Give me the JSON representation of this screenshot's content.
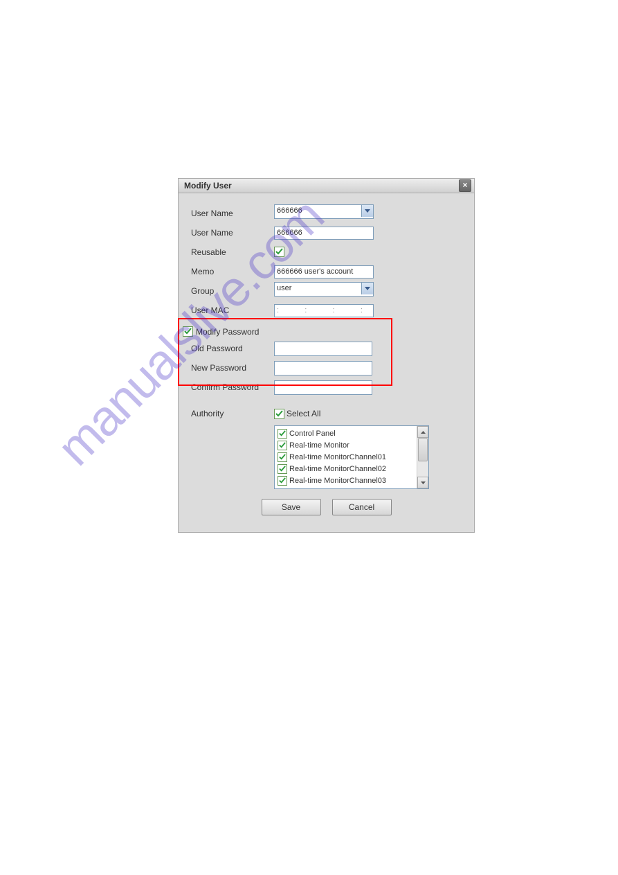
{
  "dialog": {
    "title": "Modify User",
    "fields": {
      "user_name_select_label": "User Name",
      "user_name_select_value": "666666",
      "user_name_text_label": "User Name",
      "user_name_text_value": "666666",
      "reusable_label": "Reusable",
      "reusable_checked": true,
      "memo_label": "Memo",
      "memo_value": "666666 user's account",
      "group_label": "Group",
      "group_value": "user",
      "user_mac_label": "User MAC",
      "user_mac_value": ":    :    :    :    :",
      "modify_password_label": "Modify Password",
      "modify_password_checked": true,
      "old_password_label": "Old Password",
      "new_password_label": "New Password",
      "confirm_password_label": "Confirm Password",
      "authority_label": "Authority",
      "select_all_label": "Select All",
      "select_all_checked": true
    },
    "authority_items": [
      "Control Panel",
      "Real-time Monitor",
      "Real-time MonitorChannel01",
      "Real-time MonitorChannel02",
      "Real-time MonitorChannel03"
    ],
    "buttons": {
      "save": "Save",
      "cancel": "Cancel"
    }
  },
  "watermark": "manualslive.com"
}
